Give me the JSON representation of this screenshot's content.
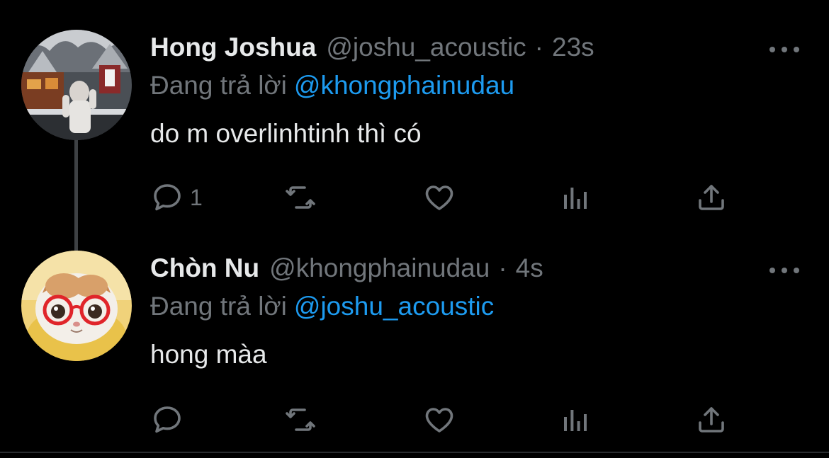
{
  "tweets": [
    {
      "author_name": "Hong Joshua",
      "handle": "@joshu_acoustic",
      "separator": "·",
      "time": "23s",
      "reply_prefix": "Đang trả lời",
      "reply_to": "@khongphainudau",
      "text": "do m overlinhtinh thì có",
      "reply_count": "1",
      "avatar": "photo-person-snowy-street"
    },
    {
      "author_name": "Chòn Nu",
      "handle": "@khongphainudau",
      "separator": "·",
      "time": "4s",
      "reply_prefix": "Đang trả lời",
      "reply_to": "@joshu_acoustic",
      "text": "hong màa",
      "reply_count": "",
      "avatar": "photo-cat-red-glasses"
    }
  ],
  "icons": {
    "reply": "speech-bubble-icon",
    "retweet": "retweet-icon",
    "like": "heart-icon",
    "views": "bar-chart-icon",
    "share": "share-icon",
    "more": "ellipsis-icon"
  },
  "colors": {
    "background": "#000000",
    "text": "#e7e9ea",
    "muted": "#71767b",
    "link": "#1d9bf0",
    "thread_line": "#3e4144"
  }
}
